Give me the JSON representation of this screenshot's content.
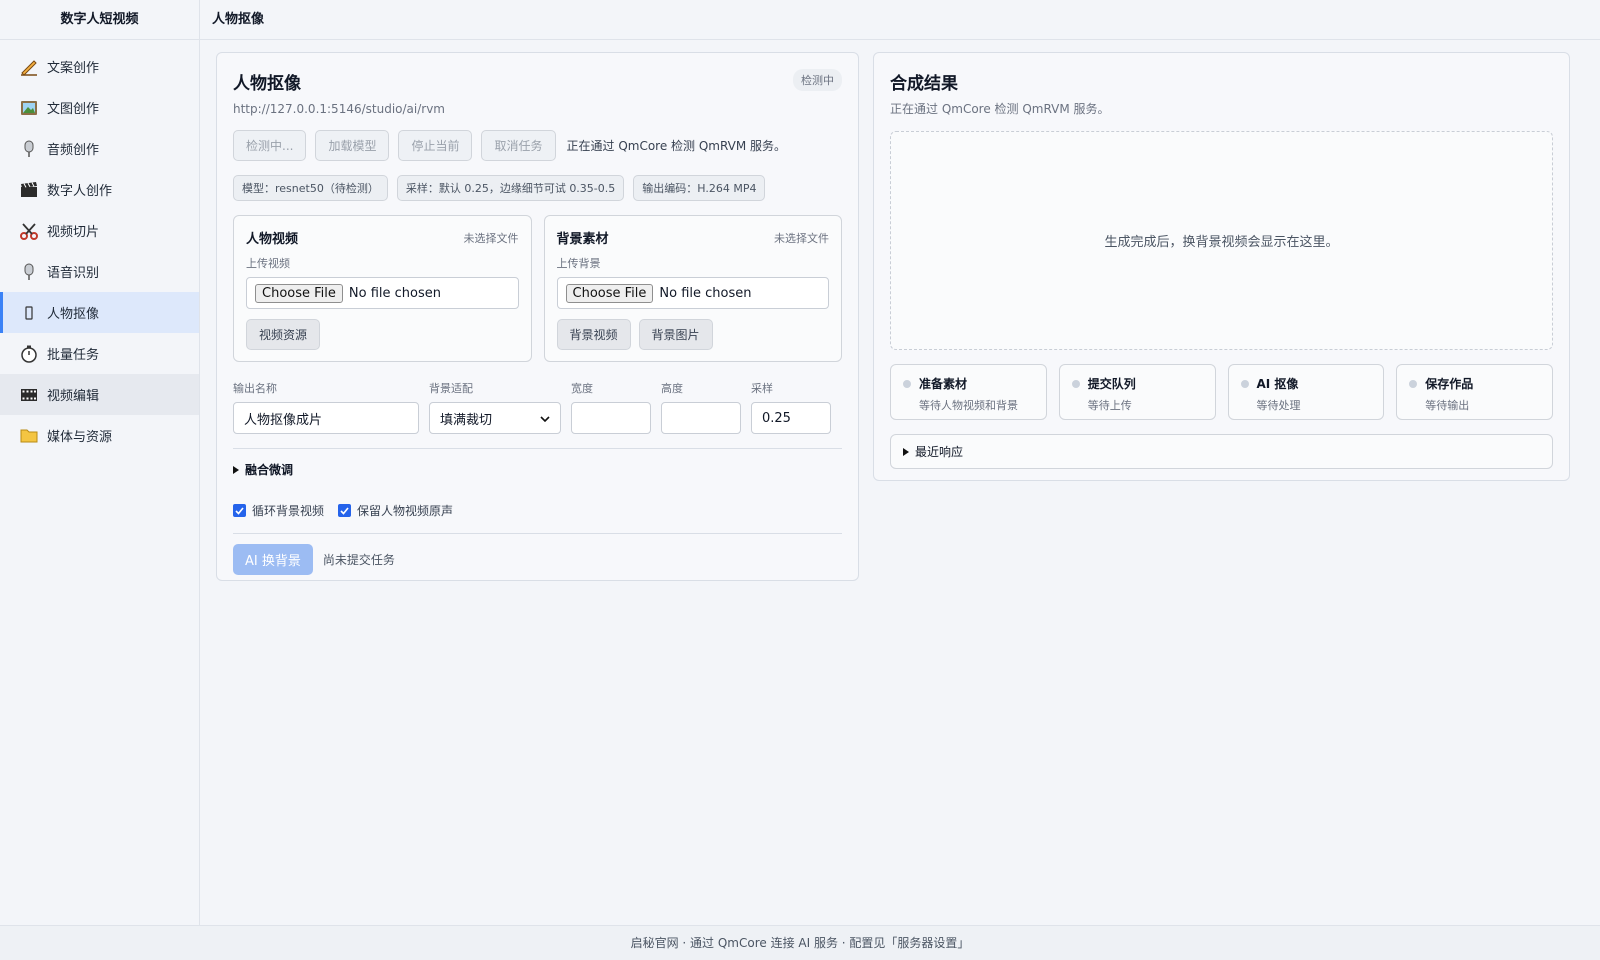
{
  "sidebar": {
    "brand": "数字人短视频",
    "items": [
      {
        "label": "文案创作",
        "icon": "pencil-icon"
      },
      {
        "label": "文图创作",
        "icon": "picture-icon"
      },
      {
        "label": "音频创作",
        "icon": "microphone-icon"
      },
      {
        "label": "数字人创作",
        "icon": "clapperboard-icon"
      },
      {
        "label": "视频切片",
        "icon": "scissors-icon"
      },
      {
        "label": "语音识别",
        "icon": "microphone-icon"
      },
      {
        "label": "人物抠像",
        "icon": "person-icon",
        "active": true
      },
      {
        "label": "批量任务",
        "icon": "stopwatch-icon"
      },
      {
        "label": "视频编辑",
        "icon": "film-icon"
      },
      {
        "label": "媒体与资源",
        "icon": "folder-icon"
      }
    ]
  },
  "header": {
    "title": "人物抠像"
  },
  "left": {
    "title": "人物抠像",
    "url": "http://127.0.0.1:5146/studio/ai/rvm",
    "status_pill": "检测中",
    "buttons": {
      "check": "检测中...",
      "load": "加载模型",
      "stop": "停止当前",
      "cancel": "取消任务"
    },
    "inline_status": "正在通过 QmCore 检测 QmRVM 服务。",
    "tags": {
      "model": "模型：resnet50（待检测）",
      "sampling": "采样：默认 0.25，边缘细节可试 0.35-0.5",
      "encoding": "输出编码：H.264 MP4"
    },
    "person_panel": {
      "title": "人物视频",
      "status": "未选择文件",
      "label": "上传视频",
      "file_button": "Choose File",
      "file_text": "No file chosen",
      "resource_button": "视频资源"
    },
    "bg_panel": {
      "title": "背景素材",
      "status": "未选择文件",
      "label": "上传背景",
      "file_button": "Choose File",
      "file_text": "No file chosen",
      "video_button": "背景视频",
      "image_button": "背景图片"
    },
    "form": {
      "output_name_label": "输出名称",
      "output_name_value": "人物抠像成片",
      "fit_label": "背景适配",
      "fit_value": "填满裁切",
      "width_label": "宽度",
      "width_value": "",
      "height_label": "高度",
      "height_value": "",
      "sampling_label": "采样",
      "sampling_value": "0.25"
    },
    "details_label": "融合微调",
    "checks": {
      "loop": "循环背景视频",
      "keep_audio": "保留人物视频原声"
    },
    "submit_label": "AI 换背景",
    "submit_status": "尚未提交任务"
  },
  "right": {
    "title": "合成结果",
    "subtitle": "正在通过 QmCore 检测 QmRVM 服务。",
    "placeholder": "生成完成后，换背景视频会显示在这里。",
    "steps": [
      {
        "title": "准备素材",
        "desc": "等待人物视频和背景"
      },
      {
        "title": "提交队列",
        "desc": "等待上传"
      },
      {
        "title": "AI 抠像",
        "desc": "等待处理"
      },
      {
        "title": "保存作品",
        "desc": "等待输出"
      }
    ],
    "response_label": "最近响应"
  },
  "footer": {
    "text": "启秘官网 · 通过 QmCore 连接 AI 服务 · 配置见「服务器设置」"
  },
  "colors": {
    "accent": "#3b82f6",
    "primary_disabled": "#9cbcf3",
    "active_nav": "#dde8fb"
  }
}
